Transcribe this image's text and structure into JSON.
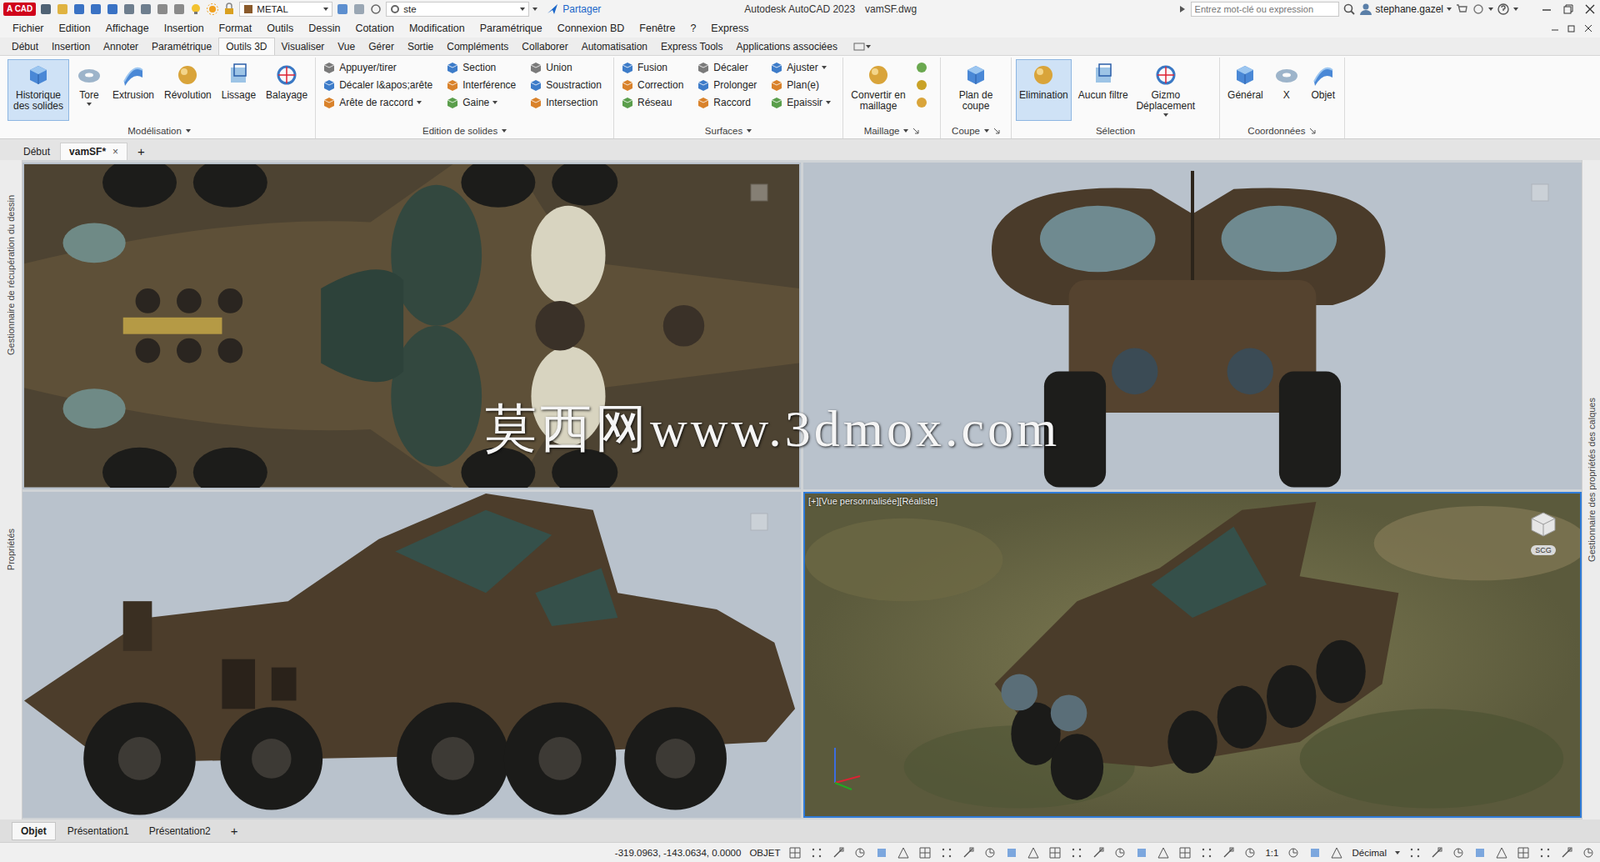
{
  "title_bar": {
    "logo": "A CAD",
    "layer": "METAL",
    "workspace": "ste",
    "share": "Partager",
    "title": "Autodesk AutoCAD 2023",
    "file": "vamSF.dwg",
    "search": {
      "placeholder": "Entrez mot-clé ou expression"
    },
    "user": "stephane.gazel"
  },
  "menu": [
    "Fichier",
    "Edition",
    "Affichage",
    "Insertion",
    "Format",
    "Outils",
    "Dessin",
    "Cotation",
    "Modification",
    "Paramétrique",
    "Connexion BD",
    "Fenêtre",
    "?",
    "Express"
  ],
  "ribbon_tabs": [
    {
      "label": "Début",
      "selected": false
    },
    {
      "label": "Insertion",
      "selected": false
    },
    {
      "label": "Annoter",
      "selected": false
    },
    {
      "label": "Paramétrique",
      "selected": false
    },
    {
      "label": "Outils 3D",
      "selected": true
    },
    {
      "label": "Visualiser",
      "selected": false
    },
    {
      "label": "Vue",
      "selected": false
    },
    {
      "label": "Gérer",
      "selected": false
    },
    {
      "label": "Sortie",
      "selected": false
    },
    {
      "label": "Compléments",
      "selected": false
    },
    {
      "label": "Collaborer",
      "selected": false
    },
    {
      "label": "Automatisation",
      "selected": false
    },
    {
      "label": "Express Tools",
      "selected": false
    },
    {
      "label": "Applications associées",
      "selected": false
    }
  ],
  "ribbon_panels": [
    {
      "title": "Modélisation",
      "dropdown": true,
      "launcher": false,
      "items": [
        {
          "label": "Historique des solides",
          "kind": "large",
          "selected": true,
          "dropdown": false
        },
        {
          "label": "Tore",
          "kind": "large",
          "selected": false,
          "dropdown": true
        },
        {
          "label": "Extrusion",
          "kind": "large",
          "selected": false,
          "dropdown": false
        },
        {
          "label": "Révolution",
          "kind": "large",
          "selected": false,
          "dropdown": false
        },
        {
          "label": "Lissage",
          "kind": "large",
          "selected": false,
          "dropdown": false
        },
        {
          "label": "Balayage",
          "kind": "large",
          "selected": false,
          "dropdown": false
        }
      ]
    },
    {
      "title": "Edition de solides",
      "dropdown": true,
      "launcher": false,
      "items": [
        {
          "label": "Appuyer/tirer",
          "kind": "small",
          "selected": false,
          "dropdown": false
        },
        {
          "label": "Décaler l&apos;arête",
          "kind": "small",
          "selected": false,
          "dropdown": false
        },
        {
          "label": "Arête de raccord",
          "kind": "small",
          "selected": false,
          "dropdown": true
        },
        {
          "label": "Section",
          "kind": "small",
          "selected": false,
          "dropdown": false
        },
        {
          "label": "Interférence",
          "kind": "small",
          "selected": false,
          "dropdown": false
        },
        {
          "label": "Gaine",
          "kind": "small",
          "selected": false,
          "dropdown": true
        },
        {
          "label": "Union",
          "kind": "small",
          "selected": false,
          "dropdown": false
        },
        {
          "label": "Soustraction",
          "kind": "small",
          "selected": false,
          "dropdown": false
        },
        {
          "label": "Intersection",
          "kind": "small",
          "selected": false,
          "dropdown": false
        }
      ]
    },
    {
      "title": "Surfaces",
      "dropdown": true,
      "launcher": false,
      "items": [
        {
          "label": "Fusion",
          "kind": "small",
          "selected": false,
          "dropdown": false
        },
        {
          "label": "Correction",
          "kind": "small",
          "selected": false,
          "dropdown": false
        },
        {
          "label": "Réseau",
          "kind": "small",
          "selected": false,
          "dropdown": false
        },
        {
          "label": "Décaler",
          "kind": "small",
          "selected": false,
          "dropdown": false
        },
        {
          "label": "Prolonger",
          "kind": "small",
          "selected": false,
          "dropdown": false
        },
        {
          "label": "Raccord",
          "kind": "small",
          "selected": false,
          "dropdown": false
        },
        {
          "label": "Ajuster",
          "kind": "small",
          "selected": false,
          "dropdown": true
        },
        {
          "label": "Plan(e)",
          "kind": "small",
          "selected": false,
          "dropdown": false
        },
        {
          "label": "Epaissir",
          "kind": "small",
          "selected": false,
          "dropdown": true
        }
      ]
    },
    {
      "title": "Maillage",
      "dropdown": true,
      "launcher": true,
      "items": [
        {
          "label": "Convertir en maillage",
          "kind": "large",
          "selected": false,
          "dropdown": false
        },
        {
          "kind": "icon",
          "selected": false,
          "dropdown": false
        },
        {
          "kind": "icon",
          "selected": false,
          "dropdown": false
        },
        {
          "kind": "icon",
          "selected": false,
          "dropdown": false
        }
      ]
    },
    {
      "title": "Coupe",
      "dropdown": true,
      "launcher": true,
      "items": [
        {
          "label": "Plan de coupe",
          "kind": "large",
          "selected": false,
          "dropdown": false
        }
      ]
    },
    {
      "title": "Sélection",
      "dropdown": false,
      "launcher": false,
      "items": [
        {
          "label": "Elimination",
          "kind": "large",
          "selected": true,
          "dropdown": false
        },
        {
          "label": "Aucun filtre",
          "kind": "large",
          "selected": false,
          "dropdown": false
        },
        {
          "label": "Gizmo Déplacement",
          "kind": "large",
          "selected": false,
          "dropdown": true
        }
      ]
    },
    {
      "title": "Coordonnées",
      "dropdown": false,
      "launcher": true,
      "items": [
        {
          "label": "Général",
          "kind": "large",
          "selected": false,
          "dropdown": false
        },
        {
          "label": "X",
          "kind": "large",
          "selected": false,
          "dropdown": false
        },
        {
          "label": "Objet",
          "kind": "large",
          "selected": false,
          "dropdown": false
        }
      ]
    }
  ],
  "file_tabs": [
    {
      "label": "Début",
      "selected": false,
      "closable": false
    },
    {
      "label": "vamSF*",
      "selected": true,
      "closable": true
    }
  ],
  "file_tab_close": "×",
  "file_tab_new": "+",
  "side_palettes": {
    "left": [
      "Gestionnaire de récupération du dessin",
      "Propriétés"
    ],
    "right": [
      "Gestionnaire des propriétés des calques"
    ]
  },
  "viewports": [
    {
      "kind": "top",
      "active": false
    },
    {
      "kind": "front",
      "active": false
    },
    {
      "kind": "side",
      "active": false
    },
    {
      "kind": "terrain",
      "active": true,
      "label": "[+][Vue personnalisée][Réaliste]",
      "badge": "SCG"
    }
  ],
  "watermark": "莫西网www.3dmox.com",
  "layout_tabs": [
    {
      "label": "Objet",
      "selected": true
    },
    {
      "label": "Présentation1",
      "selected": false
    },
    {
      "label": "Présentation2",
      "selected": false
    }
  ],
  "layout_tab_new": "+",
  "status_bar": {
    "coords": "-319.0963, -143.0634, 0.0000",
    "mode": "OBJET",
    "scale": "1:1",
    "units": "Décimal"
  }
}
